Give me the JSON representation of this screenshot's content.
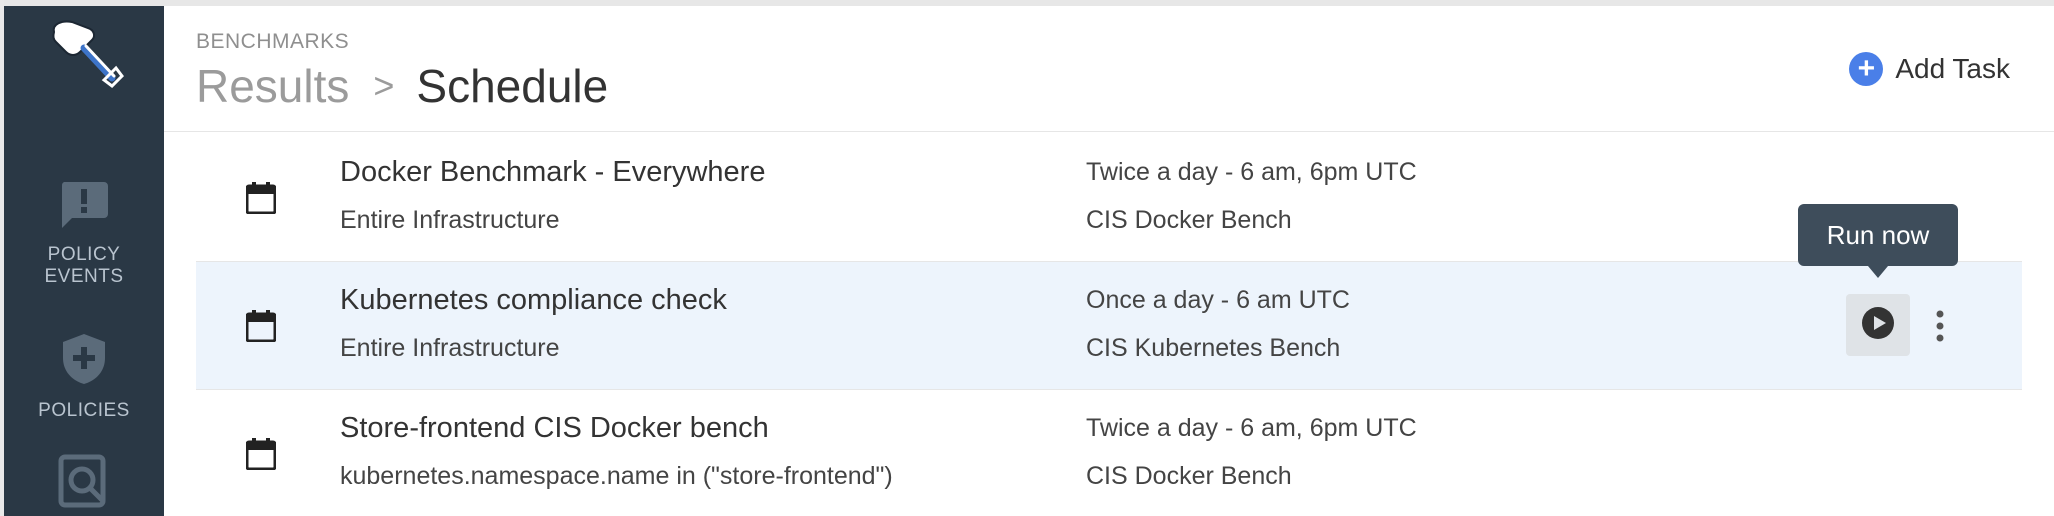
{
  "sidebar": {
    "logo_icon": "shovel-logo-icon",
    "items": [
      {
        "label_line1": "POLICY",
        "label_line2": "EVENTS",
        "icon": "alert-message-icon"
      },
      {
        "label_line1": "POLICIES",
        "icon": "shield-plus-icon"
      },
      {
        "label_line1": "",
        "icon": "search-document-icon"
      }
    ]
  },
  "header": {
    "eyebrow": "BENCHMARKS",
    "breadcrumb": {
      "parent": "Results",
      "separator": ">",
      "current": "Schedule"
    },
    "add_task_label": "Add Task",
    "add_task_icon": "plus-circle-icon",
    "accent_color": "#4a7fe8"
  },
  "tasks": [
    {
      "title": "Docker Benchmark - Everywhere",
      "scope": "Entire Infrastructure",
      "schedule": "Twice a day - 6 am, 6pm UTC",
      "benchmark": "CIS Docker Bench"
    },
    {
      "title": "Kubernetes compliance check",
      "scope": "Entire Infrastructure",
      "schedule": "Once a day - 6 am UTC",
      "benchmark": "CIS Kubernetes Bench"
    },
    {
      "title": "Store-frontend CIS Docker bench",
      "scope": "kubernetes.namespace.name in (\"store-frontend\")",
      "schedule": "Twice a day - 6 am, 6pm UTC",
      "benchmark": "CIS Docker Bench"
    }
  ],
  "row_actions": {
    "run_now_tooltip": "Run now",
    "run_icon": "play-circle-icon",
    "more_icon": "more-vertical-icon"
  },
  "colors": {
    "sidebar_bg": "#2a3845",
    "selected_row_bg": "#edf4fc",
    "tooltip_bg": "#3e4d5b"
  }
}
